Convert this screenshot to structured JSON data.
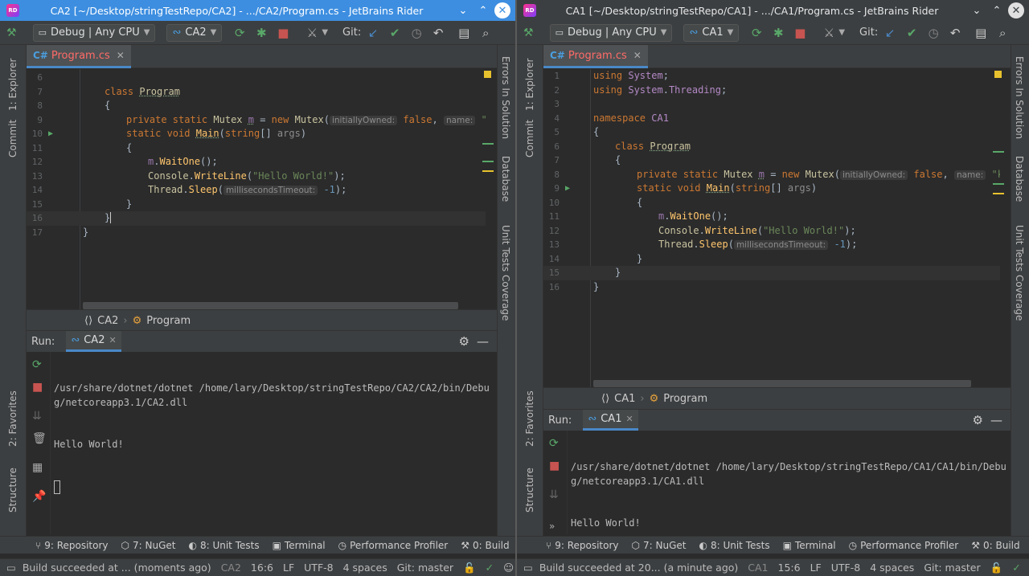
{
  "windows": [
    {
      "title": "CA2 [~/Desktop/stringTestRepo/CA2] - .../CA2/Program.cs - JetBrains Rider",
      "config_label": "Debug | Any CPU",
      "project_label": "CA2",
      "git_label": "Git:",
      "file_tab": {
        "lang": "C#",
        "name": "Program.cs"
      },
      "left_tabs": [
        "1: Explorer",
        "Commit",
        "2: Favorites",
        "Structure"
      ],
      "right_tabs": [
        "Errors In Solution",
        "Database",
        "Unit Tests Coverage"
      ],
      "code_lines": [
        {
          "n": "6",
          "text": ""
        },
        {
          "n": "7",
          "text": "class Program"
        },
        {
          "n": "8",
          "text": "{"
        },
        {
          "n": "9",
          "text": "private static Mutex m = new Mutex(initiallyOwned: false, name: \"kek\");"
        },
        {
          "n": "10",
          "text": "static void Main(string[] args)"
        },
        {
          "n": "11",
          "text": "{"
        },
        {
          "n": "12",
          "text": "m.WaitOne();"
        },
        {
          "n": "13",
          "text": "Console.WriteLine(\"Hello World!\");"
        },
        {
          "n": "14",
          "text": "Thread.Sleep(millisecondsTimeout: -1);"
        },
        {
          "n": "15",
          "text": "}"
        },
        {
          "n": "16",
          "text": "}"
        },
        {
          "n": "17",
          "text": "}"
        }
      ],
      "breadcrumb": {
        "ns": "CA2",
        "cls": "Program"
      },
      "run": {
        "label": "Run:",
        "tab": "CA2",
        "output": [
          "/usr/share/dotnet/dotnet /home/lary/Desktop/stringTestRepo/CA2/CA2/bin/Debug/netcoreapp3.1/CA2.dll",
          "Hello World!"
        ]
      },
      "bottom_tools": [
        "9: Repository",
        "7: NuGet",
        "8: Unit Tests",
        "Terminal",
        "Performance Profiler",
        "0: Build"
      ],
      "status": {
        "message": "Build succeeded at ... (moments ago)",
        "project": "CA2",
        "position": "16:6",
        "line_sep": "LF",
        "encoding": "UTF-8",
        "indent": "4 spaces",
        "git": "Git: master"
      }
    },
    {
      "title": "CA1 [~/Desktop/stringTestRepo/CA1] - .../CA1/Program.cs - JetBrains Rider",
      "config_label": "Debug | Any CPU",
      "project_label": "CA1",
      "git_label": "Git:",
      "file_tab": {
        "lang": "C#",
        "name": "Program.cs"
      },
      "left_tabs": [
        "1: Explorer",
        "Commit",
        "2: Favorites",
        "Structure"
      ],
      "right_tabs": [
        "Errors In Solution",
        "Database",
        "Unit Tests Coverage"
      ],
      "code_lines": [
        {
          "n": "1",
          "text": "using System;"
        },
        {
          "n": "2",
          "text": "using System.Threading;"
        },
        {
          "n": "3",
          "text": ""
        },
        {
          "n": "4",
          "text": "namespace CA1"
        },
        {
          "n": "5",
          "text": "{"
        },
        {
          "n": "6",
          "text": "class Program"
        },
        {
          "n": "7",
          "text": "{"
        },
        {
          "n": "8",
          "text": "private static Mutex m = new Mutex(initiallyOwned: false, name: \"kek\");"
        },
        {
          "n": "9",
          "text": "static void Main(string[] args)"
        },
        {
          "n": "10",
          "text": "{"
        },
        {
          "n": "11",
          "text": "m.WaitOne();"
        },
        {
          "n": "12",
          "text": "Console.WriteLine(\"Hello World!\");"
        },
        {
          "n": "13",
          "text": "Thread.Sleep(millisecondsTimeout: -1);"
        },
        {
          "n": "14",
          "text": "}"
        },
        {
          "n": "15",
          "text": "}"
        },
        {
          "n": "16",
          "text": "}"
        }
      ],
      "breadcrumb": {
        "ns": "CA1",
        "cls": "Program"
      },
      "run": {
        "label": "Run:",
        "tab": "CA1",
        "output": [
          "/usr/share/dotnet/dotnet /home/lary/Desktop/stringTestRepo/CA1/CA1/bin/Debug/netcoreapp3.1/CA1.dll",
          "Hello World!"
        ]
      },
      "bottom_tools": [
        "9: Repository",
        "7: NuGet",
        "8: Unit Tests",
        "Terminal",
        "Performance Profiler",
        "0: Build"
      ],
      "status": {
        "message": "Build succeeded at 20... (a minute ago)",
        "project": "CA1",
        "position": "15:6",
        "line_sep": "LF",
        "encoding": "UTF-8",
        "indent": "4 spaces",
        "git": "Git: master"
      }
    }
  ],
  "colors": {
    "active_title": "#3d8ee0",
    "inactive_title": "#3b3f42",
    "editor_bg": "#2b2b2b",
    "keyword": "#cc7832",
    "string": "#6a8759",
    "method": "#ffc66d",
    "file_tab_text": "#ff6b68"
  }
}
